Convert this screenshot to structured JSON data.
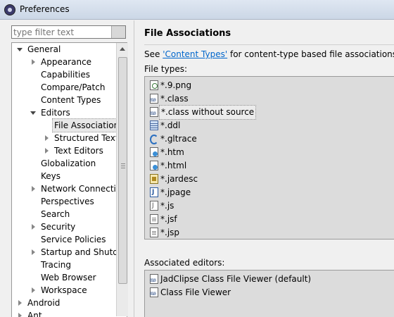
{
  "window": {
    "title": "Preferences"
  },
  "filter": {
    "placeholder": "type filter text"
  },
  "tree": {
    "items": [
      {
        "label": "General",
        "twisty": "expanded"
      },
      {
        "label": "Appearance",
        "twisty": "collapsed"
      },
      {
        "label": "Capabilities",
        "twisty": "none"
      },
      {
        "label": "Compare/Patch",
        "twisty": "none"
      },
      {
        "label": "Content Types",
        "twisty": "none"
      },
      {
        "label": "Editors",
        "twisty": "expanded"
      },
      {
        "label": "File Associations",
        "twisty": "none",
        "selected": true
      },
      {
        "label": "Structured Text E",
        "twisty": "collapsed"
      },
      {
        "label": "Text Editors",
        "twisty": "collapsed"
      },
      {
        "label": "Globalization",
        "twisty": "none"
      },
      {
        "label": "Keys",
        "twisty": "none"
      },
      {
        "label": "Network Connection",
        "twisty": "collapsed"
      },
      {
        "label": "Perspectives",
        "twisty": "none"
      },
      {
        "label": "Search",
        "twisty": "none"
      },
      {
        "label": "Security",
        "twisty": "collapsed"
      },
      {
        "label": "Service Policies",
        "twisty": "none"
      },
      {
        "label": "Startup and Shutdov",
        "twisty": "collapsed"
      },
      {
        "label": "Tracing",
        "twisty": "none"
      },
      {
        "label": "Web Browser",
        "twisty": "none"
      },
      {
        "label": "Workspace",
        "twisty": "collapsed"
      },
      {
        "label": "Android",
        "twisty": "collapsed"
      },
      {
        "label": "Ant",
        "twisty": "collapsed"
      }
    ]
  },
  "page": {
    "heading": "File Associations",
    "see_prefix": "See ",
    "see_link": "'Content Types'",
    "see_suffix": " for content-type based file associations.",
    "file_types_label": "File types:",
    "file_types": [
      {
        "label": "*.9.png",
        "icon": "image-file-icon"
      },
      {
        "label": "*.class",
        "icon": "class-file-icon"
      },
      {
        "label": "*.class without source",
        "icon": "class-file-icon",
        "selected": true
      },
      {
        "label": "*.ddl",
        "icon": "ddl-file-icon"
      },
      {
        "label": "*.gltrace",
        "icon": "gltrace-icon"
      },
      {
        "label": "*.htm",
        "icon": "web-file-icon"
      },
      {
        "label": "*.html",
        "icon": "web-file-icon"
      },
      {
        "label": "*.jardesc",
        "icon": "jar-desc-icon"
      },
      {
        "label": "*.jpage",
        "icon": "java-page-icon"
      },
      {
        "label": "*.js",
        "icon": "javascript-file-icon"
      },
      {
        "label": "*.jsf",
        "icon": "text-file-icon"
      },
      {
        "label": "*.jsp",
        "icon": "text-file-icon"
      }
    ],
    "associated_editors_label": "Associated editors:",
    "associated_editors": [
      {
        "label": "JadClipse Class File Viewer (default)",
        "icon": "class-file-icon"
      },
      {
        "label": "Class File Viewer",
        "icon": "class-file-icon"
      }
    ]
  }
}
